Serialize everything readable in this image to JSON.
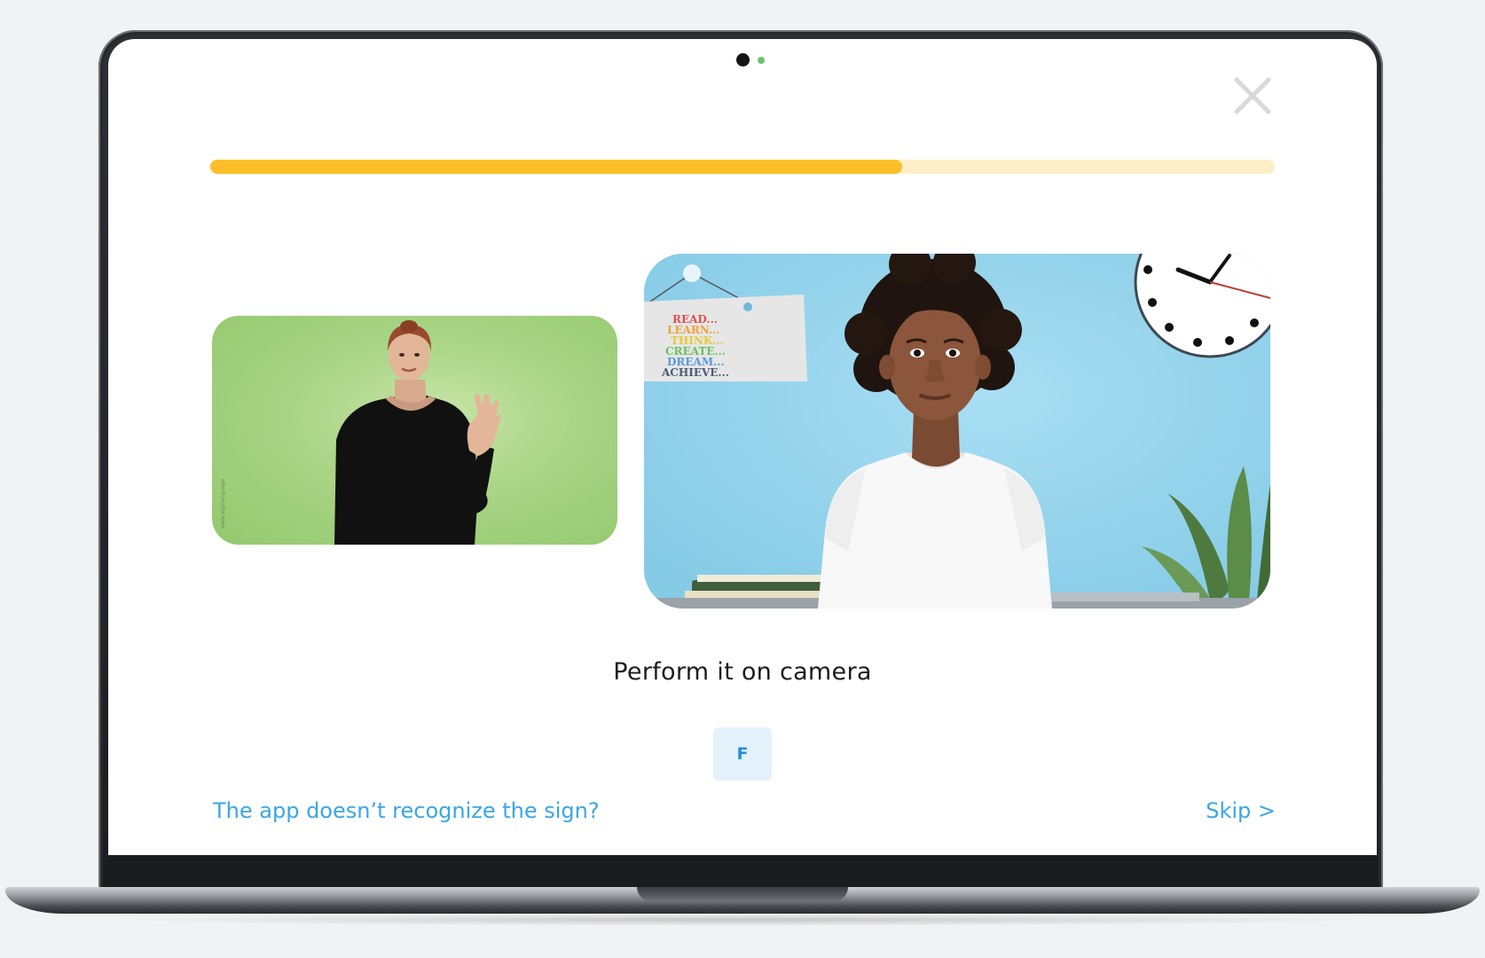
{
  "lesson": {
    "progress_fraction": 0.65,
    "prompt": "Perform it on camera",
    "letter": "F",
    "help_link": "The app doesn’t recognize the sign?",
    "skip_label": "Skip >",
    "close_icon": "close-icon"
  },
  "poster": {
    "lines": [
      "READ...",
      "LEARN...",
      "THINK...",
      "CREATE...",
      "DREAM...",
      "ACHIEVE..."
    ]
  },
  "colors": {
    "progress_fill": "#fcbf29",
    "progress_track": "#fdefc8",
    "link": "#3aa6e6",
    "chip_bg": "#e3f1fb",
    "chip_text": "#2a8fd6",
    "camera_dot": "#6cc36a"
  }
}
